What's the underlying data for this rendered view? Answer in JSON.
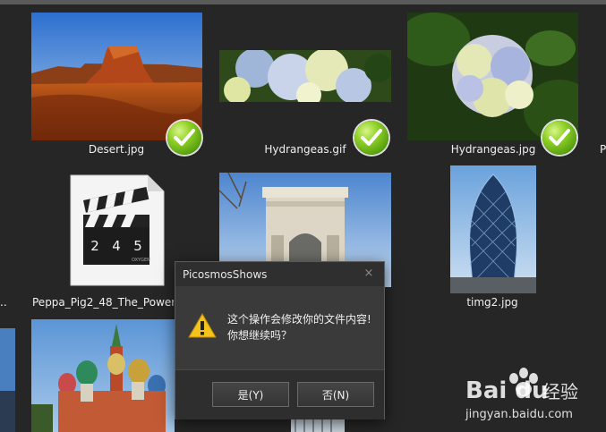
{
  "gallery": {
    "items": [
      {
        "caption": "Desert.jpg",
        "checked": true
      },
      {
        "caption": "Hydrangeas.gif",
        "checked": true
      },
      {
        "caption": "Hydrangeas.jpg",
        "checked": true
      },
      {
        "caption": "Peppa_Pig2_48_The_Power",
        "checked": false
      },
      {
        "caption": "",
        "checked": false
      },
      {
        "caption": "timg2.jpg",
        "checked": false
      }
    ],
    "edge_left_text": "..",
    "edge_right_text": "P",
    "clapper_digits": [
      "2",
      "4",
      "5"
    ],
    "clapper_label": "OXYGEN"
  },
  "dialog": {
    "title": "PicosmosShows",
    "close_glyph": "×",
    "message_line1": "这个操作会修改你的文件内容!",
    "message_line2": "你想继续吗？",
    "yes_label": "是(Y)",
    "no_label": "否(N)"
  },
  "watermark": {
    "brand": "Bai du",
    "brand_suffix": "经验",
    "url": "jingyan.baidu.com"
  },
  "colors": {
    "background": "#262626",
    "check_green": "#6cb61a",
    "warning_yellow": "#f6c21c"
  }
}
